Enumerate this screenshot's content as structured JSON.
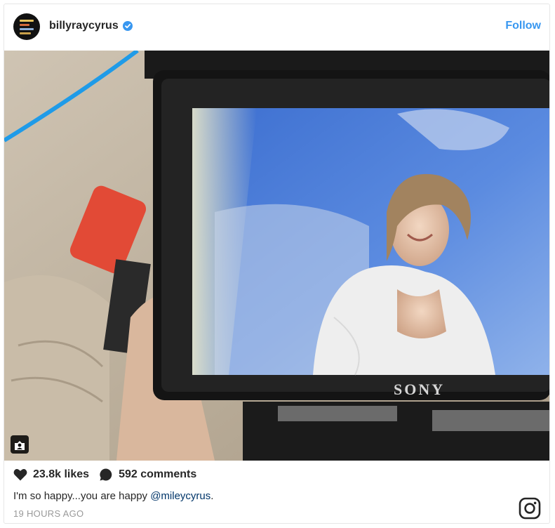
{
  "post": {
    "username": "billyraycyrus",
    "verified": true,
    "follow_label": "Follow",
    "likes": "23.8k likes",
    "comments": "592 comments",
    "caption_text": "I'm so happy...you are happy ",
    "caption_mention": "@mileycyrus",
    "caption_end": ".",
    "timestamp": "19 HOURS AGO"
  },
  "media": {
    "camera_brand": "SONY"
  },
  "icons": {
    "verified": "verified-badge-icon",
    "like": "heart-icon",
    "comment": "speech-bubble-icon",
    "tag": "user-tag-icon",
    "brand": "instagram-logo-icon"
  },
  "colors": {
    "accent": "#3897f0",
    "mention": "#003569",
    "muted": "#999999"
  }
}
